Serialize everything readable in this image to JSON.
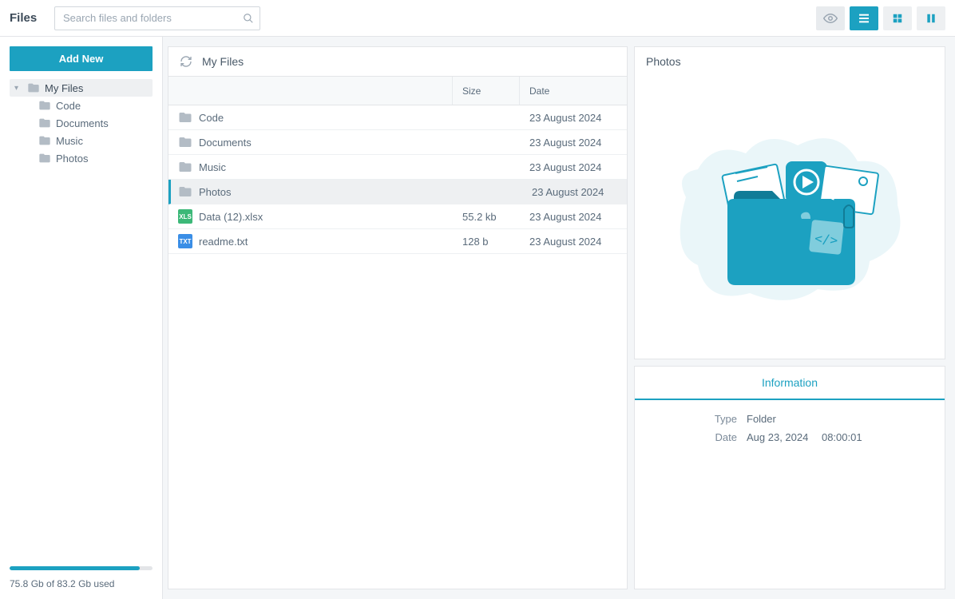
{
  "header": {
    "title": "Files",
    "search_placeholder": "Search files and folders"
  },
  "sidebar": {
    "add_new_label": "Add New",
    "root_label": "My Files",
    "children": [
      {
        "label": "Code"
      },
      {
        "label": "Documents"
      },
      {
        "label": "Music"
      },
      {
        "label": "Photos"
      }
    ],
    "storage_text": "75.8 Gb of 83.2 Gb used",
    "storage_percent": 91
  },
  "main": {
    "breadcrumb": "My Files",
    "columns": {
      "name": "",
      "size": "Size",
      "date": "Date"
    },
    "rows": [
      {
        "kind": "folder",
        "name": "Code",
        "size": "",
        "date": "23 August 2024",
        "selected": false
      },
      {
        "kind": "folder",
        "name": "Documents",
        "size": "",
        "date": "23 August 2024",
        "selected": false
      },
      {
        "kind": "folder",
        "name": "Music",
        "size": "",
        "date": "23 August 2024",
        "selected": false
      },
      {
        "kind": "folder",
        "name": "Photos",
        "size": "",
        "date": "23 August 2024",
        "selected": true
      },
      {
        "kind": "xls",
        "name": "Data (12).xlsx",
        "size": "55.2 kb",
        "date": "23 August 2024",
        "selected": false
      },
      {
        "kind": "txt",
        "name": "readme.txt",
        "size": "128 b",
        "date": "23 August 2024",
        "selected": false
      }
    ]
  },
  "preview": {
    "title": "Photos"
  },
  "info": {
    "tab_label": "Information",
    "fields": {
      "type_label": "Type",
      "type_value": "Folder",
      "date_label": "Date",
      "date_value": "Aug 23, 2024  08:00:01"
    }
  },
  "colors": {
    "accent": "#1ca1c1"
  }
}
